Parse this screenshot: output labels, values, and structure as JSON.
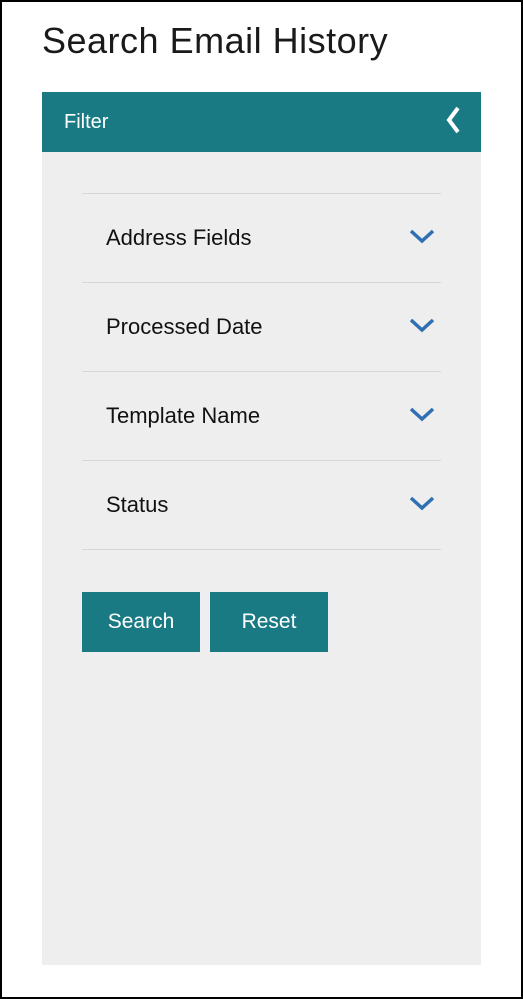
{
  "page_title": "Search Email History",
  "filter": {
    "header_label": "Filter",
    "sections": [
      {
        "label": "Address Fields"
      },
      {
        "label": "Processed Date"
      },
      {
        "label": "Template Name"
      },
      {
        "label": "Status"
      }
    ],
    "buttons": {
      "search_label": "Search",
      "reset_label": "Reset"
    }
  }
}
